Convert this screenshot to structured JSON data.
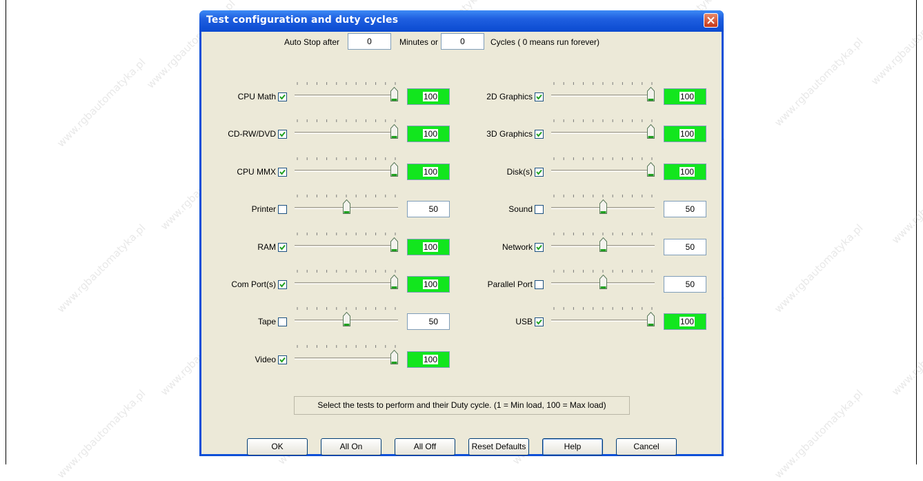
{
  "window": {
    "title": "Test configuration and duty cycles"
  },
  "autostop": {
    "prefix": "Auto Stop after",
    "minutes_value": "0",
    "minutes_label": "Minutes or",
    "cycles_value": "0",
    "cycles_label": "Cycles ( 0 means run forever)"
  },
  "tests_left": [
    {
      "label": "CPU Math",
      "checked": true,
      "value": "100",
      "level": 1.0
    },
    {
      "label": "CD-RW/DVD",
      "checked": true,
      "value": "100",
      "level": 1.0
    },
    {
      "label": "CPU MMX",
      "checked": true,
      "value": "100",
      "level": 1.0
    },
    {
      "label": "Printer",
      "checked": false,
      "value": "50",
      "level": 0.5
    },
    {
      "label": "RAM",
      "checked": true,
      "value": "100",
      "level": 1.0
    },
    {
      "label": "Com Port(s)",
      "checked": true,
      "value": "100",
      "level": 1.0
    },
    {
      "label": "Tape",
      "checked": false,
      "value": "50",
      "level": 0.5
    },
    {
      "label": "Video",
      "checked": true,
      "value": "100",
      "level": 1.0
    }
  ],
  "tests_right": [
    {
      "label": "2D Graphics",
      "checked": true,
      "value": "100",
      "level": 1.0
    },
    {
      "label": "3D Graphics",
      "checked": true,
      "value": "100",
      "level": 1.0
    },
    {
      "label": "Disk(s)",
      "checked": true,
      "value": "100",
      "level": 1.0
    },
    {
      "label": "Sound",
      "checked": false,
      "value": "50",
      "level": 0.5
    },
    {
      "label": "Network",
      "checked": true,
      "value": "50",
      "level": 0.5
    },
    {
      "label": "Parallel Port",
      "checked": false,
      "value": "50",
      "level": 0.5
    },
    {
      "label": "USB",
      "checked": true,
      "value": "100",
      "level": 1.0
    }
  ],
  "status": "Select the tests to perform and their Duty cycle. (1 = Min load, 100 = Max load)",
  "buttons": {
    "ok": "OK",
    "all_on": "All On",
    "all_off": "All Off",
    "reset": "Reset Defaults",
    "help": "Help",
    "cancel": "Cancel"
  },
  "watermark": "www.rgbautomatyka.pl",
  "colors": {
    "active_value_bg": "#12e61e",
    "title_bar": "#0a4ad0",
    "dialog_bg": "#ece9d8",
    "close_button": "#c7381a"
  }
}
